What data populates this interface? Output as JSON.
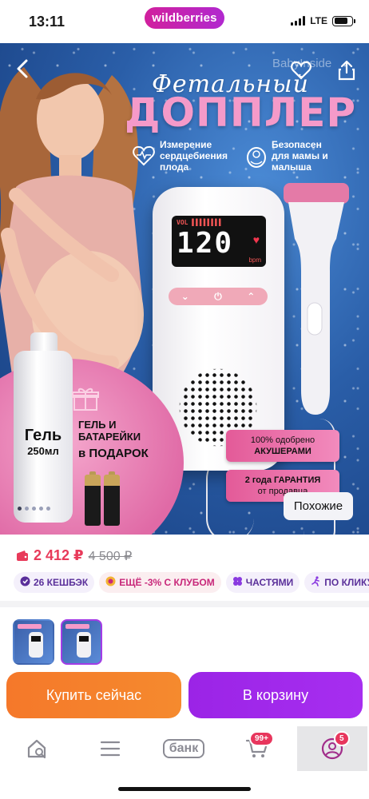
{
  "status_bar": {
    "time": "13:11",
    "brand": "wildberries",
    "network": "LTE"
  },
  "hero": {
    "brand_watermark": "BabyInside",
    "title_script": "Фетальный",
    "title_main": "ДОППЛЕР",
    "feature_1": "Измерение сердцебиения плода",
    "feature_2": "Безопасен для мамы и малыша",
    "screen_vol": "VOL ▌▌▌▌▌▌▌▌",
    "screen_value": "120",
    "screen_unit": "bpm",
    "gel_name": "Гель",
    "gel_volume": "250мл",
    "gift_line_1": "ГЕЛЬ И",
    "gift_line_2": "БАТАРЕЙКИ",
    "gift_line_3": "в ПОДАРОК",
    "claim_1_top": "100% одобрено",
    "claim_1_bottom": "АКУШЕРАМИ",
    "claim_2_top": "2 года ГАРАНТИЯ",
    "claim_2_bottom": "от продавца",
    "similar_button": "Похожие",
    "slide_count": 5,
    "active_slide": 1
  },
  "price": {
    "current": "2 412 ₽",
    "old": "4 500 ₽"
  },
  "chips": [
    {
      "label": "26 КЕШБЭК",
      "icon": "cashback-icon"
    },
    {
      "label": "ЕЩЁ -3% С КЛУБОМ",
      "icon": "club-icon"
    },
    {
      "label": "ЧАСТЯМИ",
      "icon": "parts-icon"
    },
    {
      "label": "ПО КЛИКУ",
      "icon": "click-icon"
    }
  ],
  "thumbnails": {
    "count": 2,
    "active_index": 1
  },
  "actions": {
    "buy_now": "Купить сейчас",
    "add_to_cart": "В корзину"
  },
  "bottom_nav": {
    "bank_label": "банк",
    "cart_badge": "99+",
    "profile_badge": "5"
  },
  "colors": {
    "brand": "#c324b8",
    "price": "#e83a5a",
    "buy_button": "#f5782a",
    "cart_button": "#a02ae8"
  }
}
